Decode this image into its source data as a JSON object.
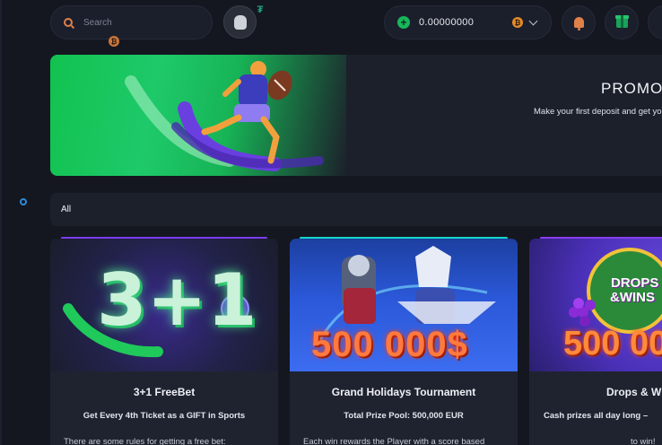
{
  "header": {
    "search_placeholder": "Search",
    "balance": "0.00000000",
    "btc_symbol": "₿",
    "tether_symbol": "₮"
  },
  "banner": {
    "title": "PROMOT",
    "subtitle": "Make your first deposit and get yo"
  },
  "filter": {
    "active": "All"
  },
  "cards": [
    {
      "title": "3+1 FreeBet",
      "subtitle": "Get Every 4th Ticket as a GIFT in Sports",
      "description": "There are some rules for getting a free bet:",
      "image_text": "3+1",
      "accent": "#7b3cf0"
    },
    {
      "title": "Grand Holidays Tournament",
      "subtitle": "Total Prize Pool: 500,000 EUR",
      "description": "Each win rewards the Player with a score based",
      "image_text": "500 000$",
      "accent": "#14d6c8"
    },
    {
      "title": "Drops & W",
      "subtitle": "Cash prizes all day long –",
      "description": "to win!",
      "image_text": "500 00",
      "badge_top": "DROPS",
      "badge_bottom": "&WINS",
      "accent": "#8a3cf0"
    }
  ],
  "colors": {
    "background": "#141720",
    "panel": "#1c202b",
    "accent_orange": "#e0814a",
    "accent_green": "#19b65b"
  }
}
